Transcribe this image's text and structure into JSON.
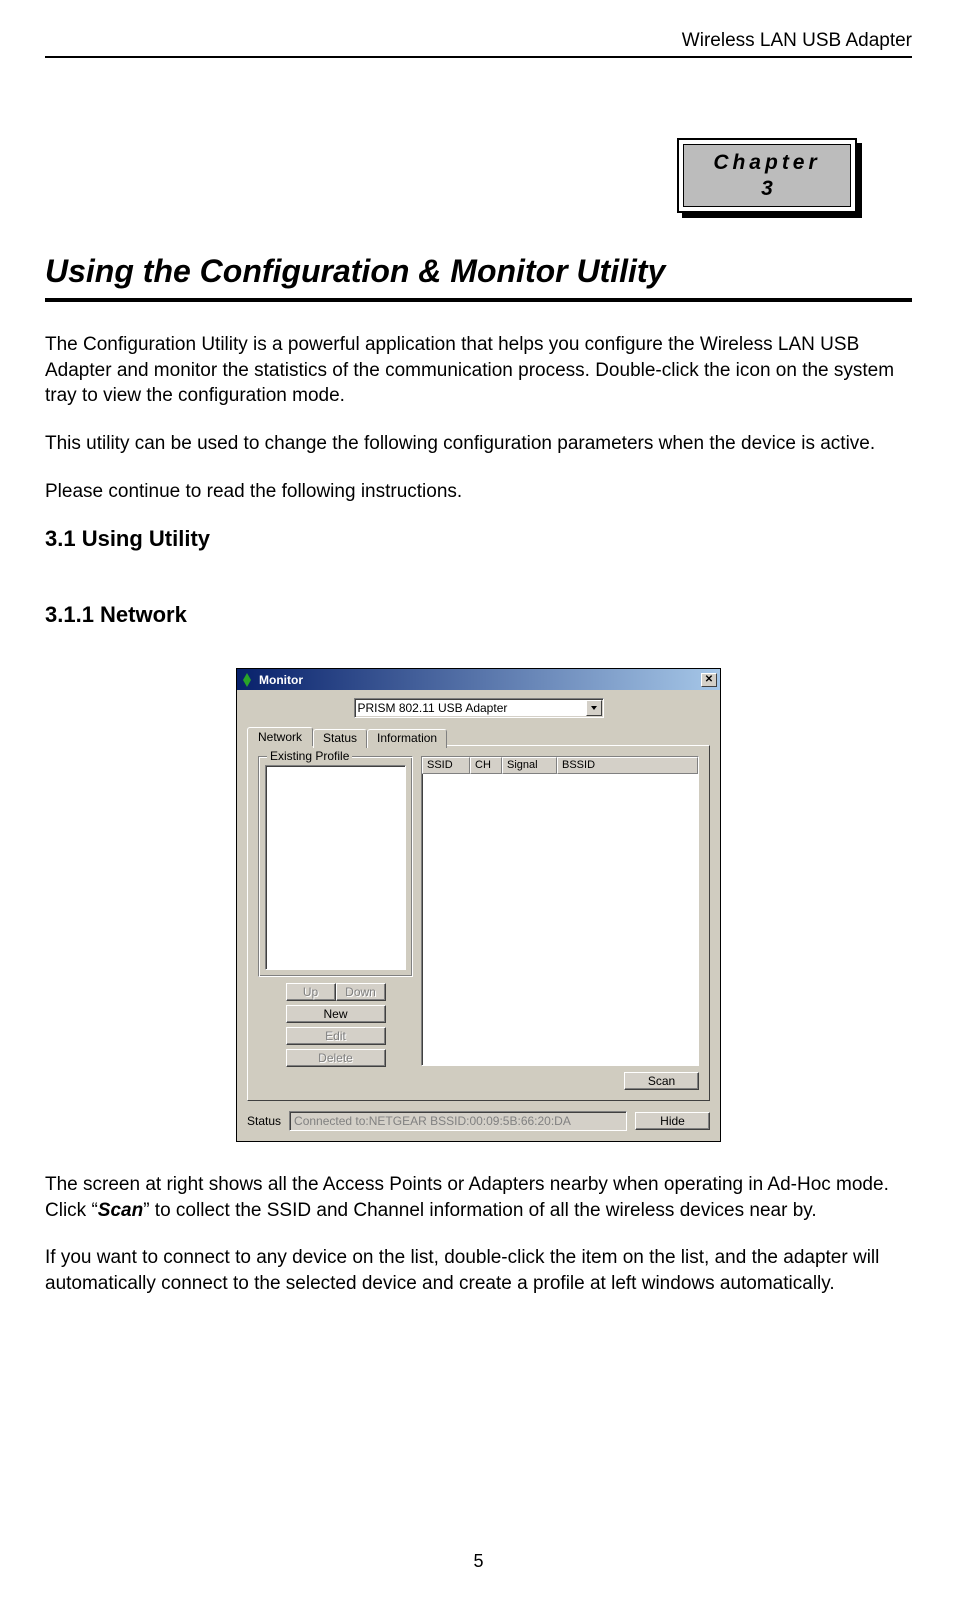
{
  "header": {
    "text": "Wireless LAN USB Adapter"
  },
  "chapter": {
    "label": "Chapter",
    "number": "3"
  },
  "title": "Using the Configuration & Monitor Utility",
  "para1": "The Configuration Utility is a powerful application that helps you configure the Wireless LAN USB Adapter and monitor the statistics of the communication process. Double-click the icon on the system tray to view the configuration mode.",
  "para2": "This utility can be used to change the following configuration parameters when the device is active.",
  "para3": "Please continue to read the following instructions.",
  "section31": "3.1 Using Utility",
  "section311": "3.1.1 Network",
  "window": {
    "title": "Monitor",
    "adapter": "PRISM 802.11 USB Adapter",
    "tabs": {
      "network": "Network",
      "status": "Status",
      "information": "Information"
    },
    "group_label": "Existing Profile",
    "columns": {
      "ssid": "SSID",
      "ch": "CH",
      "signal": "Signal",
      "bssid": "BSSID"
    },
    "buttons": {
      "up": "Up",
      "down": "Down",
      "new": "New",
      "edit": "Edit",
      "delete": "Delete",
      "scan": "Scan",
      "hide": "Hide"
    },
    "status_label": "Status",
    "status_value": "Connected to:NETGEAR    BSSID:00:09:5B:66:20:DA"
  },
  "para4_a": "The screen at right shows all the Access Points or Adapters nearby when operating in Ad-Hoc mode. Click ",
  "para4_quote1": "“",
  "para4_scan": "Scan",
  "para4_quote2": "”",
  "para4_b": " to collect the SSID and Channel information of all the wireless devices near by.",
  "para5": "If you want to connect to any device on the list, double-click the item on the list, and the adapter will automatically connect to the selected device and create a profile at left windows automatically.",
  "page_number": "5"
}
